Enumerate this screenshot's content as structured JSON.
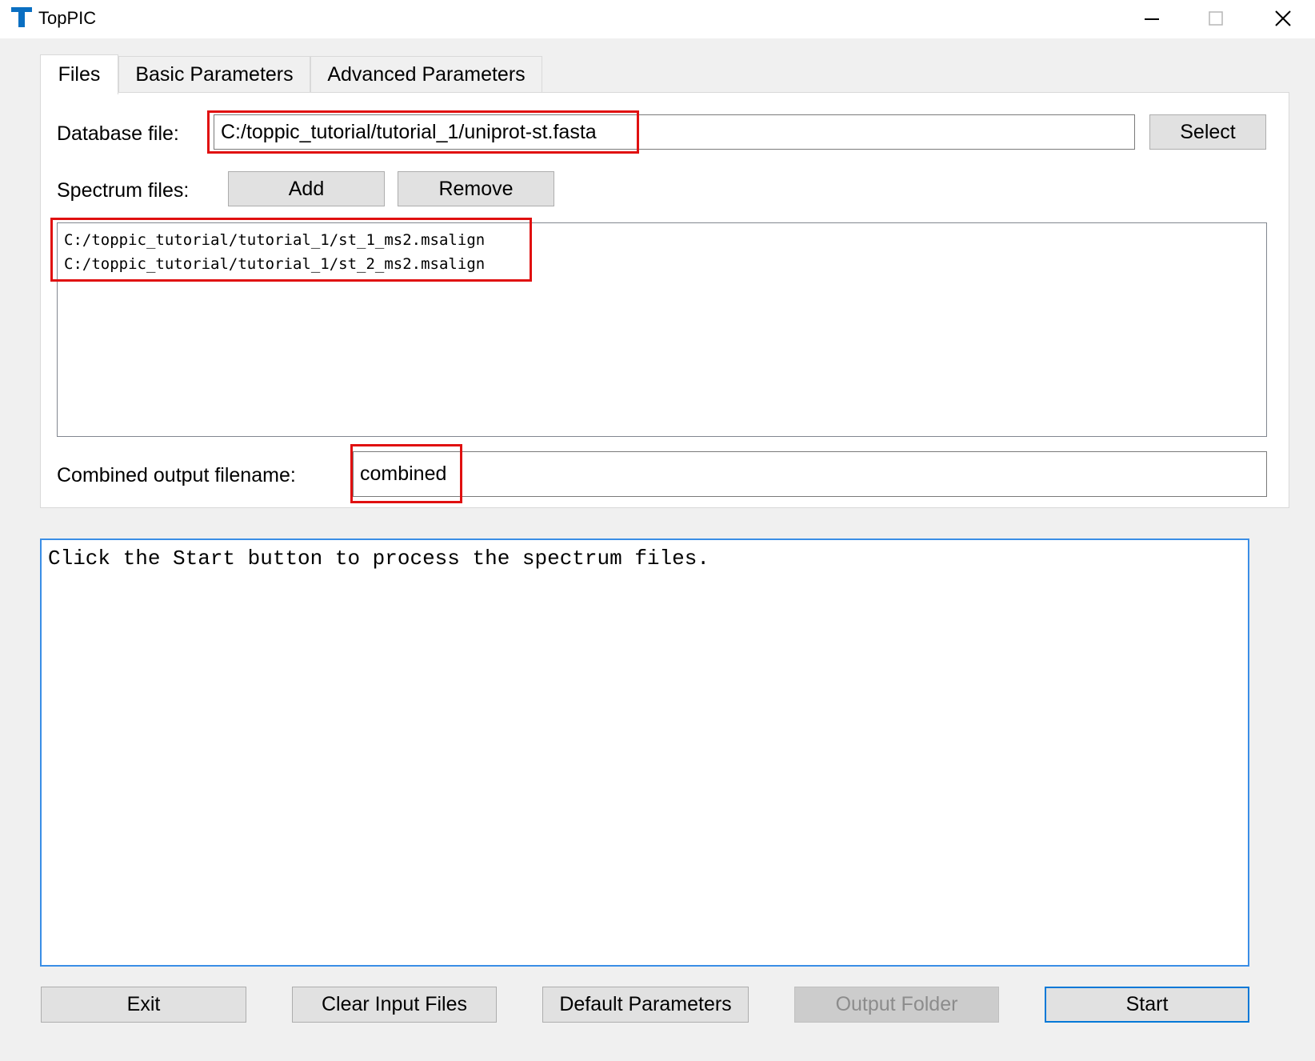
{
  "window": {
    "title": "TopPIC",
    "icon": "toppic-logo-icon",
    "controls": [
      "minimize-icon",
      "maximize-icon",
      "close-icon"
    ]
  },
  "tabs": [
    {
      "label": "Files",
      "active": true
    },
    {
      "label": "Basic Parameters",
      "active": false
    },
    {
      "label": "Advanced Parameters",
      "active": false
    }
  ],
  "files_tab": {
    "database_label": "Database file:",
    "database_value": "C:/toppic_tutorial/tutorial_1/uniprot-st.fasta",
    "select_button": "Select",
    "spectrum_label": "Spectrum files:",
    "add_button": "Add",
    "remove_button": "Remove",
    "spectrum_files": [
      "C:/toppic_tutorial/tutorial_1/st_1_ms2.msalign",
      "C:/toppic_tutorial/tutorial_1/st_2_ms2.msalign"
    ],
    "combined_label": "Combined output filename:",
    "combined_value": "combined"
  },
  "log": {
    "text": "Click the Start button to process the spectrum files."
  },
  "buttons": {
    "exit": "Exit",
    "clear_input": "Clear Input Files",
    "default_params": "Default Parameters",
    "output_folder": "Output Folder",
    "start": "Start"
  },
  "colors": {
    "annotation_highlight": "#e01010",
    "focus_accent": "#0078d7",
    "app_icon": "#0a6fc2"
  }
}
